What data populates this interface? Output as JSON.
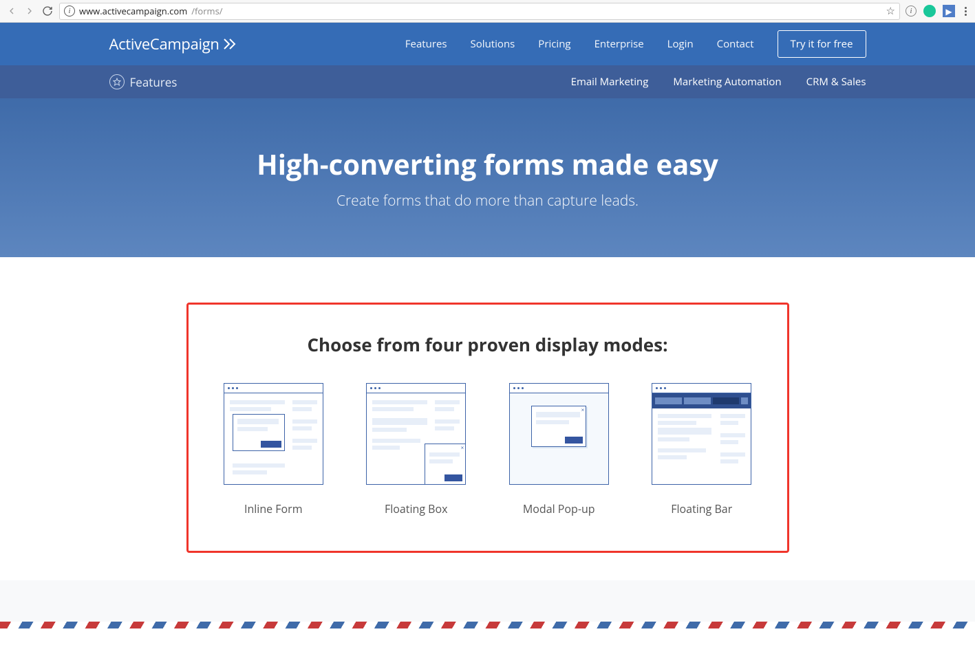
{
  "browser": {
    "url_domain": "www.activecampaign.com",
    "url_path": "/forms/"
  },
  "brand": "ActiveCampaign",
  "primary_nav": {
    "items": [
      "Features",
      "Solutions",
      "Pricing",
      "Enterprise",
      "Login",
      "Contact"
    ],
    "cta": "Try it for free"
  },
  "sub_nav": {
    "label": "Features",
    "items": [
      "Email Marketing",
      "Marketing Automation",
      "CRM & Sales"
    ]
  },
  "hero": {
    "title": "High-converting forms made easy",
    "subtitle": "Create forms that do more than capture leads."
  },
  "section": {
    "heading": "Choose from four proven display modes:",
    "modes": [
      "Inline Form",
      "Floating Box",
      "Modal Pop-up",
      "Floating Bar"
    ]
  }
}
